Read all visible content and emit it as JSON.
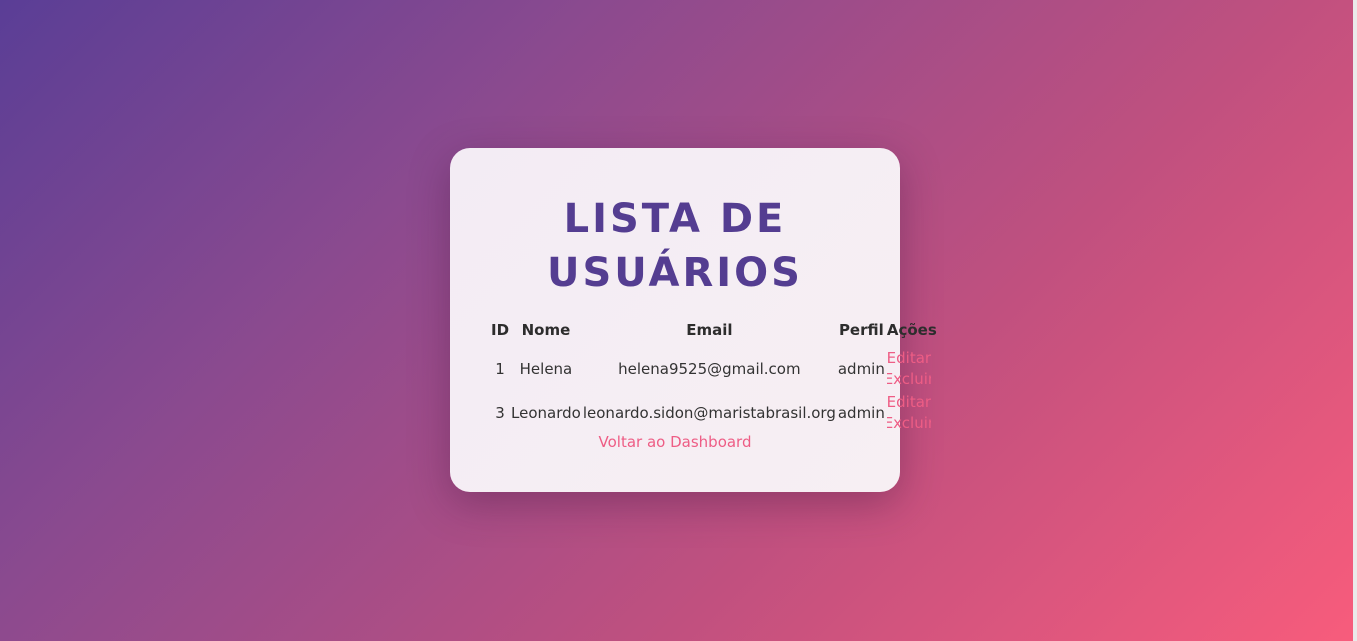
{
  "page": {
    "title_line1": "LISTA DE",
    "title_line2": "USUÁRIOS",
    "back_link": "Voltar ao Dashboard"
  },
  "table": {
    "headers": {
      "id": "ID",
      "nome": "Nome",
      "email": "Email",
      "perfil": "Perfil",
      "acoes": "Ações"
    },
    "rows": [
      {
        "id": "1",
        "nome": "Helena",
        "email": "helena9525@gmail.com",
        "perfil": "admin",
        "edit": "Editar",
        "delete": "Excluir"
      },
      {
        "id": "3",
        "nome": "Leonardo",
        "email": "leonardo.sidon@maristabrasil.org",
        "perfil": "admin",
        "edit": "Editar",
        "delete": "Excluir"
      }
    ]
  },
  "colors": {
    "title": "#543d91",
    "link": "#ee5d85",
    "gradient_start": "#5a3e96",
    "gradient_end": "#f85c7c"
  }
}
